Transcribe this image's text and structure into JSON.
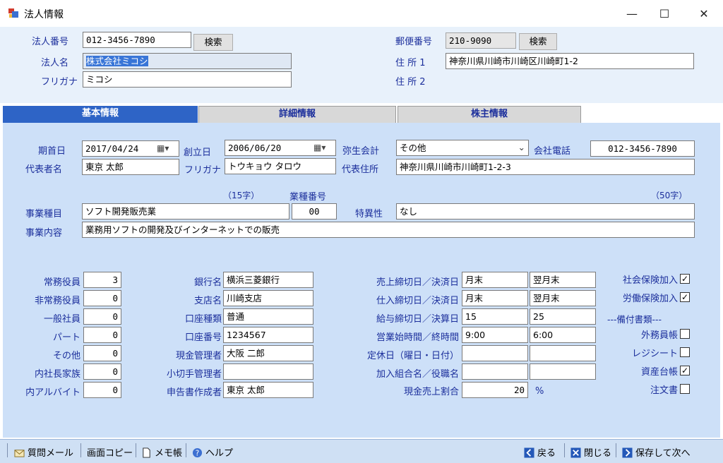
{
  "window": {
    "title": "法人情報"
  },
  "header": {
    "corp_no_label": "法人番号",
    "corp_no": "012-3456-7890",
    "search_label": "検索",
    "corp_name_label": "法人名",
    "corp_name": "株式会社ミコシ",
    "furigana_label": "フリガナ",
    "furigana": "ミコシ",
    "postal_label": "郵便番号",
    "postal": "210-9090",
    "postal_search_label": "検索",
    "addr1_label": "住 所 1",
    "addr1": "神奈川県川崎市川崎区川崎町1-2",
    "addr2_label": "住 所 2"
  },
  "tabs": [
    {
      "label": "基本情報",
      "active": true
    },
    {
      "label": "詳細情報",
      "active": false
    },
    {
      "label": "株主情報",
      "active": false
    }
  ],
  "basic": {
    "fiscal_start_label": "期首日",
    "fiscal_start": "2017/04/24",
    "founded_label": "創立日",
    "founded": "2006/06/20",
    "yayoi_label": "弥生会計",
    "yayoi": "その他",
    "phone_label": "会社電話",
    "phone": "012-3456-7890",
    "rep_label": "代表者名",
    "rep": "東京 太郎",
    "rep_kana_label": "フリガナ",
    "rep_kana": "トウキョウ タロウ",
    "rep_addr_label": "代表住所",
    "rep_addr": "神奈川県川崎市川崎町1-2-3",
    "limit15": "（15字）",
    "industry_no_label": "業種番号",
    "limit50": "（50字）",
    "biz_type_label": "事業種目",
    "biz_type": "ソフト開発販売業",
    "industry_no": "00",
    "special_label": "特異性",
    "special": "なし",
    "biz_desc_label": "事業内容",
    "biz_desc": "業務用ソフトの開発及びインターネットでの販売"
  },
  "staff": [
    {
      "label": "常務役員",
      "value": "3"
    },
    {
      "label": "非常務役員",
      "value": "0"
    },
    {
      "label": "一般社員",
      "value": "0"
    },
    {
      "label": "パート",
      "value": "0"
    },
    {
      "label": "その他",
      "value": "0"
    },
    {
      "label": "内社長家族",
      "value": "0"
    },
    {
      "label": "内アルバイト",
      "value": "0"
    }
  ],
  "bank": [
    {
      "label": "銀行名",
      "value": "横浜三菱銀行"
    },
    {
      "label": "支店名",
      "value": "川崎支店"
    },
    {
      "label": "口座種類",
      "value": "普通"
    },
    {
      "label": "口座番号",
      "value": "1234567"
    },
    {
      "label": "現金管理者",
      "value": "大阪 二郎"
    },
    {
      "label": "小切手管理者",
      "value": ""
    },
    {
      "label": "申告書作成者",
      "value": "東京 太郎"
    }
  ],
  "closing": [
    {
      "label": "売上締切日／決済日",
      "a": "月末",
      "b": "翌月末"
    },
    {
      "label": "仕入締切日／決済日",
      "a": "月末",
      "b": "翌月末"
    },
    {
      "label": "給与締切日／決算日",
      "a": "15",
      "b": "25"
    },
    {
      "label": "営業始時間／終時間",
      "a": "9:00",
      "b": "6:00"
    },
    {
      "label": "定休日（曜日・日付）",
      "a": "",
      "b": ""
    },
    {
      "label": "加入組合名／役職名",
      "a": "",
      "b": ""
    }
  ],
  "cash_ratio": {
    "label": "現金売上割合",
    "value": "20",
    "unit": "%"
  },
  "checks": [
    {
      "label": "社会保険加入",
      "checked": true
    },
    {
      "label": "労働保険加入",
      "checked": true
    },
    {
      "label": "外務員帳",
      "checked": false
    },
    {
      "label": "レジシート",
      "checked": false
    },
    {
      "label": "資産台帳",
      "checked": true
    },
    {
      "label": "注文書",
      "checked": false
    }
  ],
  "books_heading": "---備付書類---",
  "toolbar": {
    "mail": "質問メール",
    "copy": "画面コピー",
    "memo": "メモ帳",
    "help": "ヘルプ",
    "back": "戻る",
    "close": "閉じる",
    "save_next": "保存して次へ"
  }
}
